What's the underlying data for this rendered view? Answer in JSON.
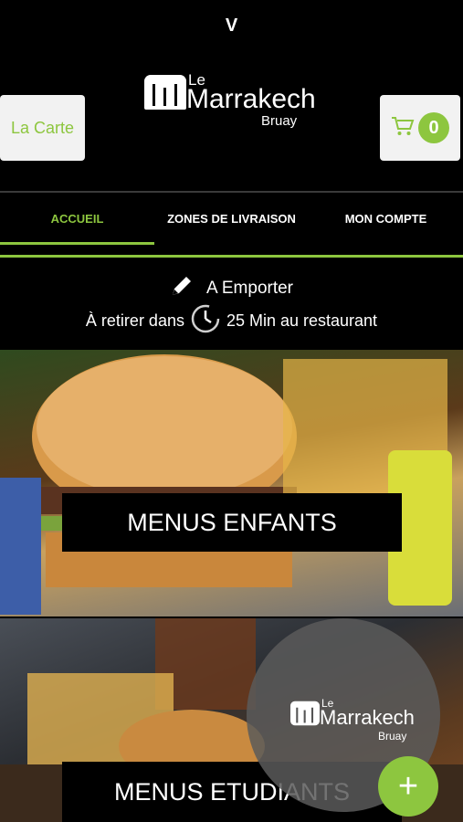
{
  "status": {
    "letter": "V"
  },
  "header": {
    "carte_label": "La Carte",
    "cart_count": "0",
    "logo": {
      "le": "Le",
      "name": "Marrakech",
      "city": "Bruay"
    }
  },
  "tabs": [
    {
      "label": "ACCUEIL",
      "active": true
    },
    {
      "label": "ZONES DE LIVRAISON",
      "active": false
    },
    {
      "label": "MON COMPTE",
      "active": false
    }
  ],
  "delivery": {
    "mode": "A Emporter",
    "prefix": "À retirer dans",
    "time": "25 Min au restaurant"
  },
  "categories": [
    {
      "label": "MENUS ENFANTS"
    },
    {
      "label": "MENUS ETUDIANTS"
    }
  ],
  "fab": {
    "logo": {
      "le": "Le",
      "name": "Marrakech",
      "city": "Bruay"
    },
    "plus": "+"
  },
  "colors": {
    "accent": "#8dc63f",
    "background": "#000000",
    "button_bg": "#f2f2f2"
  },
  "icons": [
    "cart-icon",
    "pencil-icon",
    "clock-icon",
    "plus-icon"
  ]
}
